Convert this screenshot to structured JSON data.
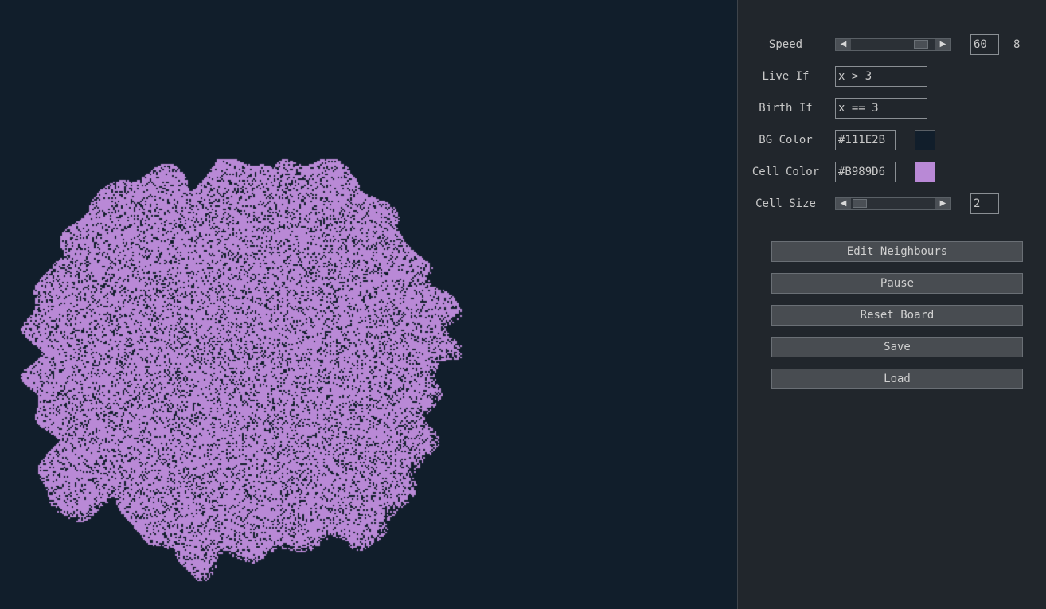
{
  "colors": {
    "board_bg": "#111E2B",
    "panel_bg": "#21262C",
    "cell": "#B989D6"
  },
  "controls": {
    "speed": {
      "label": "Speed",
      "value": "60",
      "extra": "8",
      "fraction": 0.9
    },
    "live_if": {
      "label": "Live If",
      "value": "x > 3"
    },
    "birth_if": {
      "label": "Birth If",
      "value": "x == 3"
    },
    "bg_color": {
      "label": "BG Color",
      "value": "#111E2B"
    },
    "cell_color": {
      "label": "Cell Color",
      "value": "#B989D6"
    },
    "cell_size": {
      "label": "Cell Size",
      "value": "2",
      "fraction": 0.02
    }
  },
  "buttons": {
    "edit_neighbours": "Edit Neighbours",
    "pause": "Pause",
    "reset_board": "Reset Board",
    "save": "Save",
    "load": "Load"
  },
  "icons": {
    "scroll_left": "◀",
    "scroll_right": "▶"
  }
}
